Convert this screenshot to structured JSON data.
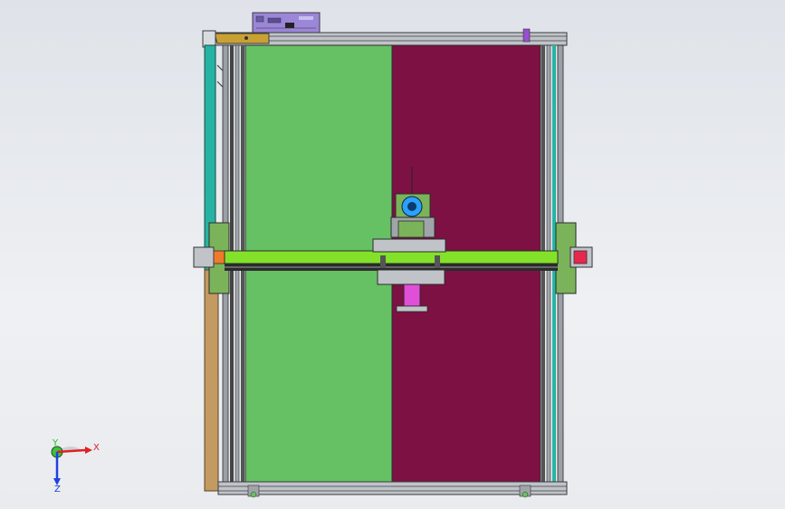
{
  "viewport": {
    "background_top": "#dfe3e9",
    "background_bottom": "#e9ebee"
  },
  "model": {
    "name": "",
    "colors": {
      "frame": "#c0c4c8",
      "frame_dark": "#3a3d40",
      "left_bed": "#66c064",
      "right_bed": "#7d1143",
      "gantry_beam": "#84e12a",
      "left_rail": "#27b3a3",
      "left_lower_panel": "#c49a63",
      "top_bracket": "#c9a032",
      "control_box": "#9b86d8",
      "carriage_body": "#7bb35a",
      "tool_block": "#e04fd8",
      "end_cap_left": "#f07a2a",
      "end_cap_right": "#e8274f",
      "motor_disc": "#2aa0ff"
    }
  },
  "triad": {
    "x_label": "X",
    "y_label": "Y",
    "z_label": "Z",
    "x_color": "#e02020",
    "y_color": "#20c020",
    "z_color": "#2040e0"
  }
}
